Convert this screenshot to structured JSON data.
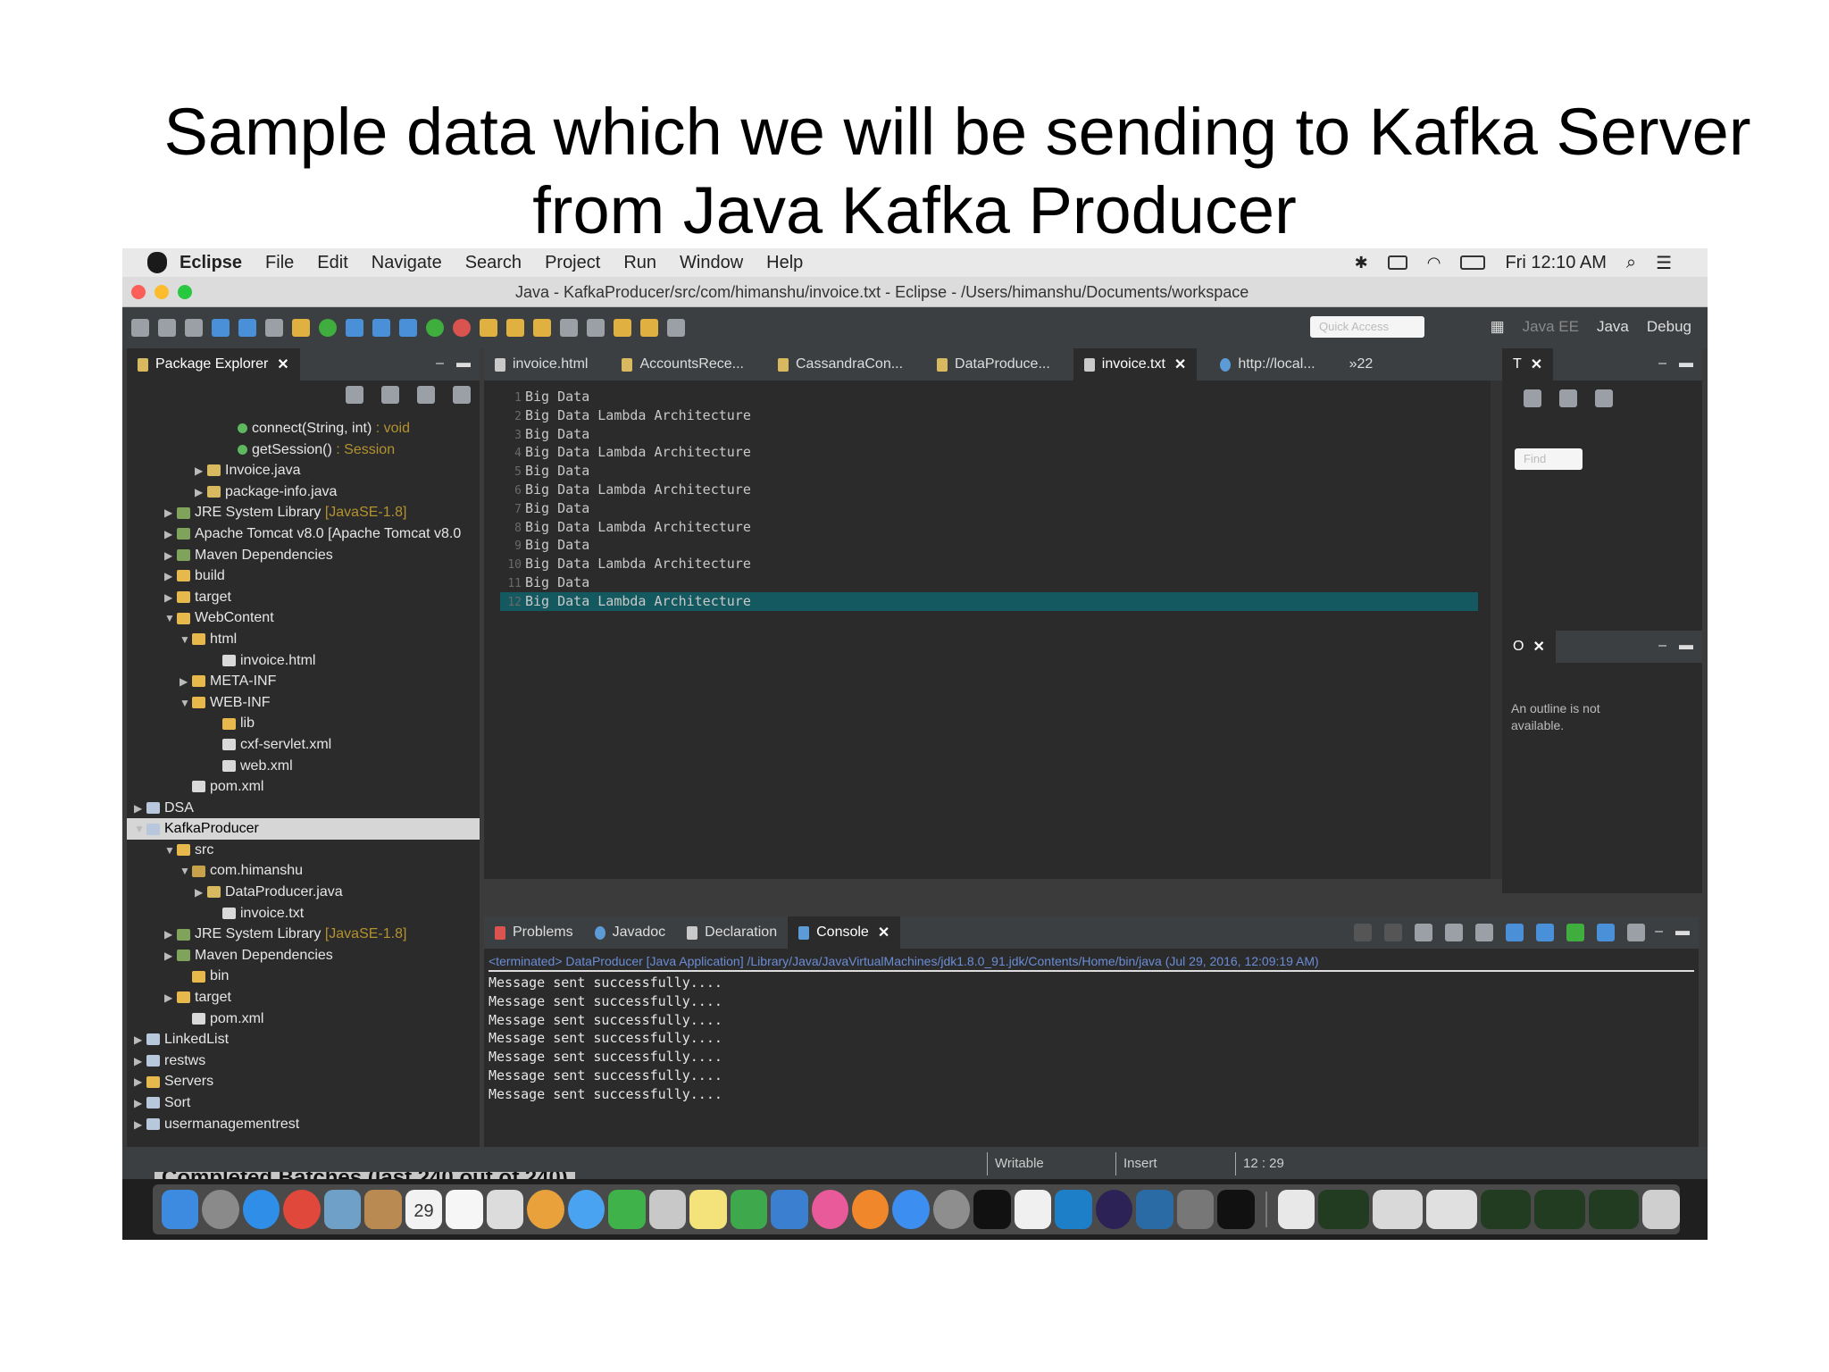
{
  "slide_title": {
    "line1": "Sample data which we will be sending to Kafka Server",
    "line2": "from Java Kafka Producer"
  },
  "menubar": {
    "app": "Eclipse",
    "items": [
      "File",
      "Edit",
      "Navigate",
      "Search",
      "Project",
      "Run",
      "Window",
      "Help"
    ],
    "clock": "Fri 12:10 AM"
  },
  "window": {
    "title": "Java - KafkaProducer/src/com/himanshu/invoice.txt - Eclipse - /Users/himanshu/Documents/workspace"
  },
  "toolbar": {
    "quick_access_placeholder": "Quick Access",
    "perspectives": [
      "Java EE",
      "Java",
      "Debug"
    ]
  },
  "package_explorer": {
    "tab_label": "Package Explorer",
    "tree": [
      {
        "indent": 6,
        "arrow": "",
        "icon": "method",
        "label": "connect(String, int)",
        "sub": " : void"
      },
      {
        "indent": 6,
        "arrow": "",
        "icon": "method",
        "label": "getSession()",
        "sub": " : Session"
      },
      {
        "indent": 4,
        "arrow": "▶",
        "icon": "java",
        "label": "Invoice.java",
        "sub": ""
      },
      {
        "indent": 4,
        "arrow": "▶",
        "icon": "java",
        "label": "package-info.java",
        "sub": ""
      },
      {
        "indent": 2,
        "arrow": "▶",
        "icon": "lib",
        "label": "JRE System Library",
        "sub": " [JavaSE-1.8]"
      },
      {
        "indent": 2,
        "arrow": "▶",
        "icon": "lib",
        "label": "Apache Tomcat v8.0 [Apache Tomcat v8.0",
        "sub": ""
      },
      {
        "indent": 2,
        "arrow": "▶",
        "icon": "lib",
        "label": "Maven Dependencies",
        "sub": ""
      },
      {
        "indent": 2,
        "arrow": "▶",
        "icon": "folder",
        "label": "build",
        "sub": ""
      },
      {
        "indent": 2,
        "arrow": "▶",
        "icon": "folder",
        "label": "target",
        "sub": ""
      },
      {
        "indent": 2,
        "arrow": "▼",
        "icon": "folder",
        "label": "WebContent",
        "sub": ""
      },
      {
        "indent": 3,
        "arrow": "▼",
        "icon": "folder",
        "label": "html",
        "sub": ""
      },
      {
        "indent": 5,
        "arrow": "",
        "icon": "file",
        "label": "invoice.html",
        "sub": ""
      },
      {
        "indent": 3,
        "arrow": "▶",
        "icon": "folder",
        "label": "META-INF",
        "sub": ""
      },
      {
        "indent": 3,
        "arrow": "▼",
        "icon": "folder",
        "label": "WEB-INF",
        "sub": ""
      },
      {
        "indent": 5,
        "arrow": "",
        "icon": "folder",
        "label": "lib",
        "sub": ""
      },
      {
        "indent": 5,
        "arrow": "",
        "icon": "file",
        "label": "cxf-servlet.xml",
        "sub": ""
      },
      {
        "indent": 5,
        "arrow": "",
        "icon": "file",
        "label": "web.xml",
        "sub": ""
      },
      {
        "indent": 3,
        "arrow": "",
        "icon": "file",
        "label": "pom.xml",
        "sub": ""
      },
      {
        "indent": 0,
        "arrow": "▶",
        "icon": "proj",
        "label": "DSA",
        "sub": ""
      },
      {
        "indent": 0,
        "arrow": "▼",
        "icon": "proj",
        "label": "KafkaProducer",
        "sub": "",
        "selected": true
      },
      {
        "indent": 2,
        "arrow": "▼",
        "icon": "folder",
        "label": "src",
        "sub": ""
      },
      {
        "indent": 3,
        "arrow": "▼",
        "icon": "pkg",
        "label": "com.himanshu",
        "sub": ""
      },
      {
        "indent": 4,
        "arrow": "▶",
        "icon": "java",
        "label": "DataProducer.java",
        "sub": ""
      },
      {
        "indent": 5,
        "arrow": "",
        "icon": "file",
        "label": "invoice.txt",
        "sub": ""
      },
      {
        "indent": 2,
        "arrow": "▶",
        "icon": "lib",
        "label": "JRE System Library",
        "sub": " [JavaSE-1.8]"
      },
      {
        "indent": 2,
        "arrow": "▶",
        "icon": "lib",
        "label": "Maven Dependencies",
        "sub": ""
      },
      {
        "indent": 3,
        "arrow": "",
        "icon": "folder",
        "label": "bin",
        "sub": ""
      },
      {
        "indent": 2,
        "arrow": "▶",
        "icon": "folder",
        "label": "target",
        "sub": ""
      },
      {
        "indent": 3,
        "arrow": "",
        "icon": "file",
        "label": "pom.xml",
        "sub": ""
      },
      {
        "indent": 0,
        "arrow": "▶",
        "icon": "proj",
        "label": "LinkedList",
        "sub": ""
      },
      {
        "indent": 0,
        "arrow": "▶",
        "icon": "proj",
        "label": "restws",
        "sub": ""
      },
      {
        "indent": 0,
        "arrow": "▶",
        "icon": "folder",
        "label": "Servers",
        "sub": ""
      },
      {
        "indent": 0,
        "arrow": "▶",
        "icon": "proj",
        "label": "Sort",
        "sub": ""
      },
      {
        "indent": 0,
        "arrow": "▶",
        "icon": "proj",
        "label": "usermanagementrest",
        "sub": ""
      }
    ]
  },
  "editor": {
    "tabs": [
      {
        "label": "invoice.html",
        "icon": "file"
      },
      {
        "label": "AccountsRece...",
        "icon": "java"
      },
      {
        "label": "CassandraCon...",
        "icon": "java"
      },
      {
        "label": "DataProduce...",
        "icon": "java"
      },
      {
        "label": "invoice.txt",
        "icon": "file",
        "active": true
      },
      {
        "label": "http://local...",
        "icon": "web"
      }
    ],
    "overflow": "»22",
    "lines": [
      "Big Data",
      "Big Data Lambda Architecture",
      "Big Data",
      "Big Data Lambda Architecture",
      "Big Data",
      "Big Data Lambda Architecture",
      "Big Data",
      "Big Data Lambda Architecture",
      "Big Data",
      "Big Data Lambda Architecture",
      "Big Data",
      "Big Data Lambda Architecture"
    ],
    "line_numbers": [
      "1",
      "2",
      "3",
      "4",
      "5",
      "6",
      "7",
      "8",
      "9",
      "10",
      "11",
      "12"
    ]
  },
  "task_panel": {
    "find_placeholder": "Find"
  },
  "outline_panel": {
    "message": "An outline is not available."
  },
  "bottom_panel": {
    "tabs": [
      "Problems",
      "Javadoc",
      "Declaration",
      "Console"
    ],
    "active_tab": "Console",
    "terminated": "<terminated> DataProducer [Java Application] /Library/Java/JavaVirtualMachines/jdk1.8.0_91.jdk/Contents/Home/bin/java (Jul 29, 2016, 12:09:19 AM)",
    "output": [
      "Message sent successfully....",
      "Message sent successfully....",
      "Message sent successfully....",
      "Message sent successfully....",
      "Message sent successfully....",
      "Message sent successfully....",
      "Message sent successfully...."
    ]
  },
  "statusbar": {
    "writable": "Writable",
    "insert": "Insert",
    "position": "12 : 29"
  },
  "background_text": "Completed Batches (last 240 out of 240)",
  "dock": {
    "calendar_day": "29"
  }
}
